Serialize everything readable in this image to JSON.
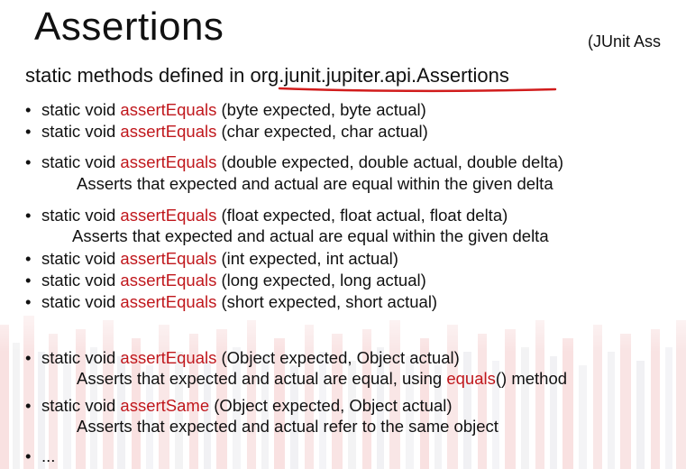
{
  "title": "Assertions",
  "subtitle_right": "(JUnit Ass",
  "intro": {
    "prefix": "static methods defined in ",
    "package": "org.junit.jupiter.api.Assertions"
  },
  "items": [
    {
      "prefix": "static void ",
      "method": "assertEquals",
      "params": " (byte expected, byte actual)"
    },
    {
      "prefix": "static void ",
      "method": "assertEquals",
      "params": " (char expected, char actual)"
    },
    {
      "prefix": "static void ",
      "method": "assertEquals",
      "params": " (double expected, double actual, double delta)"
    },
    {
      "prefix": "static void ",
      "method": "assertEquals",
      "params": " (float expected, float actual, float delta)"
    },
    {
      "prefix": "static void ",
      "method": "assertEquals",
      "params": " (int expected, int actual)"
    },
    {
      "prefix": "static void ",
      "method": "assertEquals",
      "params": " (long expected, long actual)"
    },
    {
      "prefix": "static void ",
      "method": "assertEquals",
      "params": " (short expected, short actual)"
    },
    {
      "prefix": "static void ",
      "method": "assertEquals",
      "params": " (Object  expected, Object actual)"
    },
    {
      "prefix": "static void ",
      "method": "assertSame",
      "params": " (Object  expected, Object actual)"
    },
    {
      "ellipsis": "..."
    }
  ],
  "descriptions": {
    "double_delta": "Asserts that expected and actual are equal within the given delta",
    "float_delta": "Asserts that expected and actual are equal within the given delta",
    "object_equals_prefix": "Asserts that expected and actual are equal, using ",
    "object_equals_method": "equals",
    "object_equals_suffix": "() method",
    "same_object": "Asserts that expected and actual refer to the same object"
  },
  "bullet_char": "•",
  "colors": {
    "accent_red": "#c0171c",
    "text": "#111111",
    "underline": "#d11c1c"
  }
}
